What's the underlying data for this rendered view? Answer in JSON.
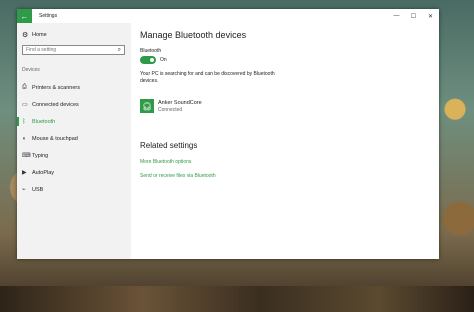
{
  "window": {
    "title": "Settings",
    "back_glyph": "←",
    "controls": {
      "minimize": "—",
      "maximize": "☐",
      "close": "✕"
    }
  },
  "sidebar": {
    "home_label": "Home",
    "home_icon": "gear-icon",
    "search_placeholder": "Find a setting",
    "section_label": "Devices",
    "items": [
      {
        "label": "Printers & scanners",
        "icon": "printer-icon",
        "active": false
      },
      {
        "label": "Connected devices",
        "icon": "devices-icon",
        "active": false
      },
      {
        "label": "Bluetooth",
        "icon": "bluetooth-icon",
        "active": true
      },
      {
        "label": "Mouse & touchpad",
        "icon": "mouse-icon",
        "active": false
      },
      {
        "label": "Typing",
        "icon": "keyboard-icon",
        "active": false
      },
      {
        "label": "AutoPlay",
        "icon": "autoplay-icon",
        "active": false
      },
      {
        "label": "USB",
        "icon": "usb-icon",
        "active": false
      }
    ]
  },
  "main": {
    "title": "Manage Bluetooth devices",
    "bluetooth_label": "Bluetooth",
    "toggle_state": "On",
    "discover_text": "Your PC is searching for and can be discovered by Bluetooth devices.",
    "device": {
      "name": "Anker SoundCore",
      "status": "Connected",
      "icon": "headphones-icon"
    },
    "related_title": "Related settings",
    "links": [
      "More Bluetooth options",
      "Send or receive files via Bluetooth"
    ]
  },
  "colors": {
    "accent": "#2f9a47",
    "sidebar_bg": "#f2f2f2",
    "window_bg": "#ffffff"
  }
}
